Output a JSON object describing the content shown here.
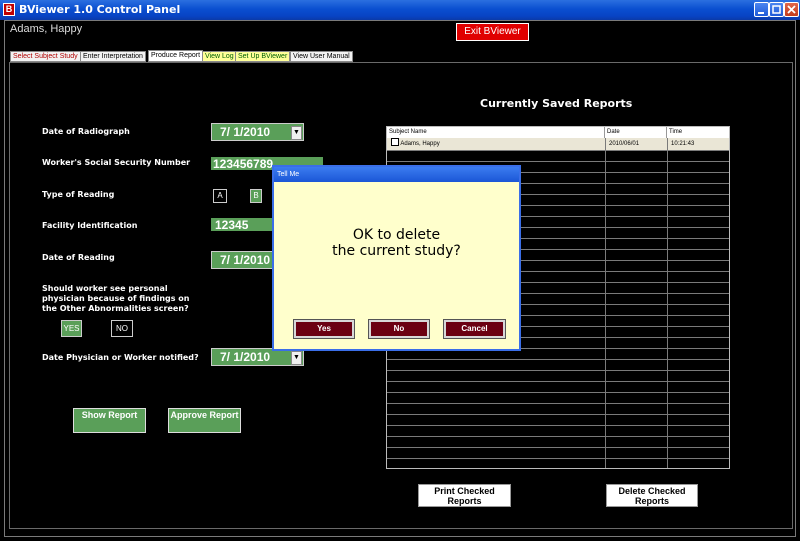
{
  "window": {
    "title": "BViewer 1.0 Control Panel",
    "icon": "B"
  },
  "header": {
    "user": "Adams, Happy",
    "exit_label": "Exit BViewer"
  },
  "tabs": [
    {
      "label": "Select Subject Study"
    },
    {
      "label": "Enter Interpretation"
    },
    {
      "label": "Produce Report"
    },
    {
      "label": "View Log"
    },
    {
      "label": "Set Up BViewer"
    },
    {
      "label": "View User Manual"
    }
  ],
  "form": {
    "date_radiograph_label": "Date of Radiograph",
    "date_radiograph_value": "7/ 1/2010",
    "ssn_label": "Worker's Social Security Number",
    "ssn_value": "123456789",
    "type_reading_label": "Type of Reading",
    "type_a": "A",
    "type_b": "B",
    "facility_label": "Facility Identification",
    "facility_value": "12345",
    "date_reading_label": "Date of Reading",
    "date_reading_value": "7/ 1/2010",
    "physician_question": "Should worker see personal physician because of findings on the Other Abnormalities screen?",
    "yes_label": "YES",
    "no_label": "NO",
    "date_notified_label": "Date Physician or Worker notified?",
    "date_notified_value": "7/ 1/2010",
    "dropdown_arrow": "▼"
  },
  "buttons": {
    "show_report": "Show Report",
    "approve_report": "Approve Report",
    "print_checked": "Print Checked Reports",
    "delete_checked": "Delete Checked Reports"
  },
  "reports": {
    "title": "Currently Saved Reports",
    "columns": [
      "Subject Name",
      "Date",
      "Time"
    ],
    "rows": [
      {
        "name": "Adams, Happy",
        "date": "2010/06/01",
        "time": "10:21:43"
      }
    ]
  },
  "dialog": {
    "title": "Tell Me",
    "message_line1": "OK to delete",
    "message_line2": "the current study?",
    "yes": "Yes",
    "no": "No",
    "cancel": "Cancel"
  }
}
